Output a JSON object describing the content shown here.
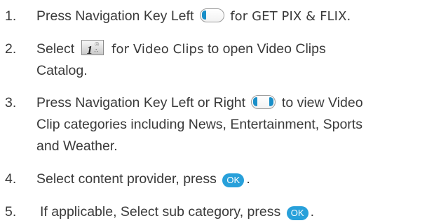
{
  "steps": [
    {
      "number": "1.",
      "before": "Press Navigation Key Left",
      "alt": "for GET PIX & FLIX."
    },
    {
      "number": "2.",
      "before": "Select",
      "alt": "for Video Clips",
      "after": "to open Video Clips",
      "line2": "Catalog."
    },
    {
      "number": "3.",
      "before": "Press Navigation Key Left or Right",
      "after": "to view Video",
      "line2": "Clip categories including News, Entertainment, Sports",
      "line3": "and Weather."
    },
    {
      "number": "4.",
      "before": "Select content provider, press",
      "ok": "OK",
      "after": "."
    },
    {
      "number": "5.",
      "before": "If applicable, Select sub category, press",
      "ok": "OK",
      "after": "."
    }
  ],
  "icons": {
    "nav_key_left": "nav-key-left-icon",
    "nav_key_left_right": "nav-key-left-right-icon",
    "key_1": "keypad-1-icon",
    "ok": "ok-button-icon"
  },
  "colors": {
    "text": "#3a3a3a",
    "nav_accent": "#1a8fc8",
    "ok_button": "#28a0da"
  }
}
